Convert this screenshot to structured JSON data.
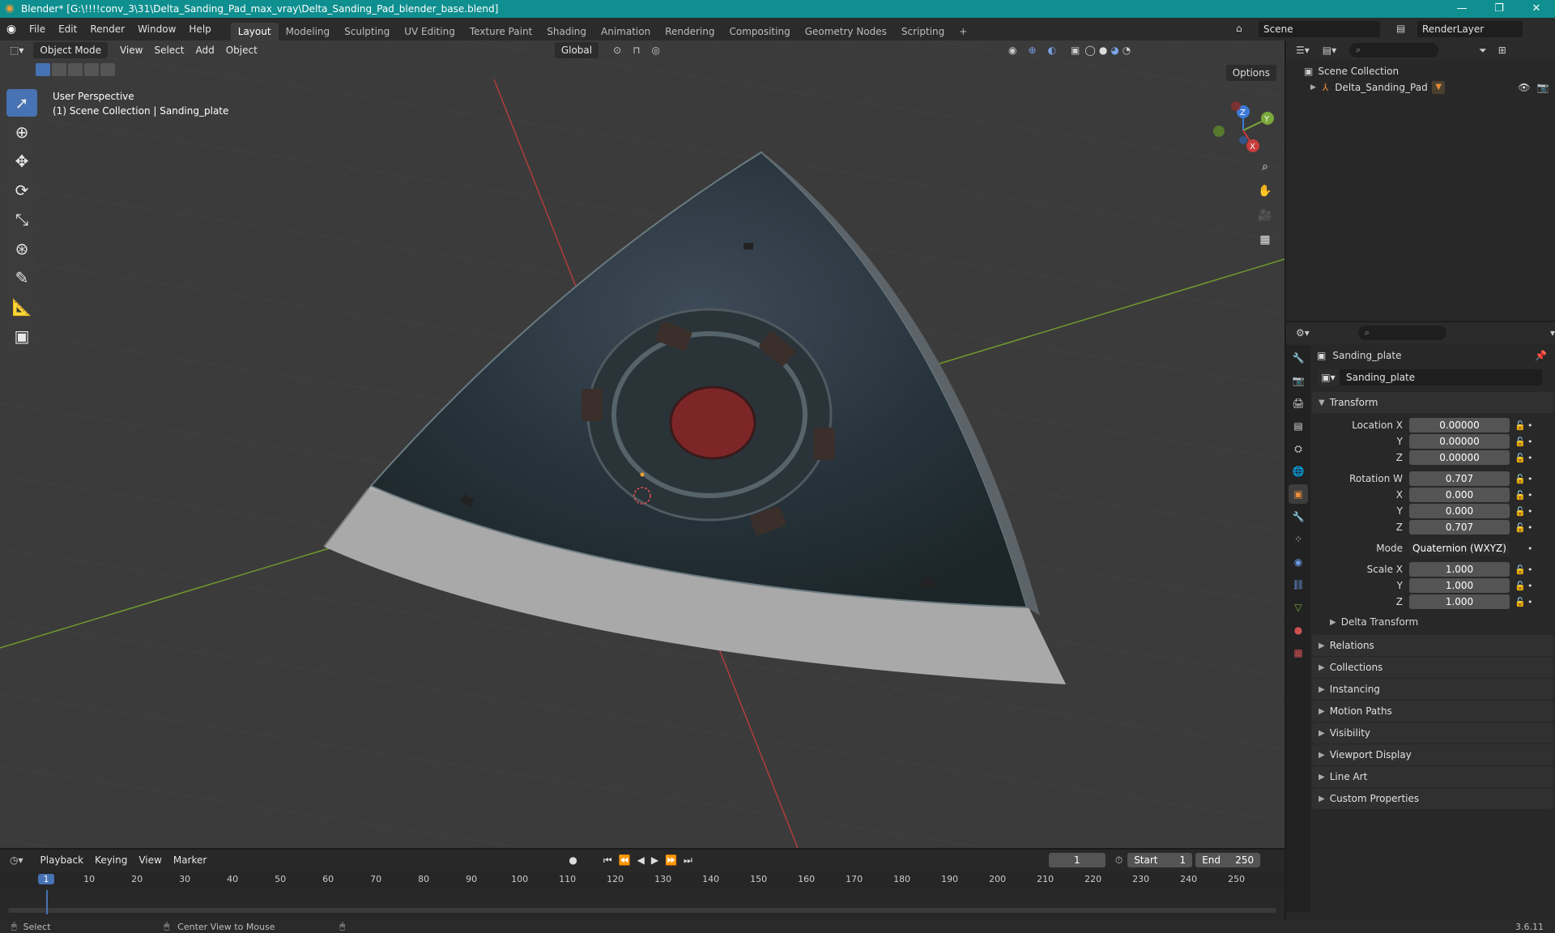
{
  "window": {
    "title": "Blender* [G:\\!!!!conv_3\\31\\Delta_Sanding_Pad_max_vray\\Delta_Sanding_Pad_blender_base.blend]",
    "controls": [
      "—",
      "❐",
      "✕"
    ]
  },
  "menu": [
    "File",
    "Edit",
    "Render",
    "Window",
    "Help"
  ],
  "workspaces": [
    "Layout",
    "Modeling",
    "Sculpting",
    "UV Editing",
    "Texture Paint",
    "Shading",
    "Animation",
    "Rendering",
    "Compositing",
    "Geometry Nodes",
    "Scripting",
    "+"
  ],
  "scene": {
    "name": "Scene",
    "render_layer": "RenderLayer"
  },
  "viewport": {
    "mode": "Object Mode",
    "menus": [
      "View",
      "Select",
      "Add",
      "Object"
    ],
    "transform_orientation": "Global",
    "options_label": "Options",
    "info_line1": "User Perspective",
    "info_line2": "(1) Scene Collection | Sanding_plate",
    "gizmo_labels": {
      "x": "X",
      "y": "Y",
      "z": "Z"
    }
  },
  "outliner": {
    "root": "Scene Collection",
    "items": [
      {
        "name": "Delta_Sanding_Pad"
      }
    ]
  },
  "properties": {
    "object_name": "Sanding_plate",
    "data_name": "Sanding_plate",
    "transform_header": "Transform",
    "location": {
      "label": "Location X",
      "x": "0.00000",
      "y": "0.00000",
      "z": "0.00000"
    },
    "rotation": {
      "label": "Rotation W",
      "w": "0.707",
      "x": "0.000",
      "y": "0.000",
      "z": "0.707"
    },
    "mode_label": "Mode",
    "mode_value": "Quaternion (WXYZ)",
    "scale": {
      "label": "Scale X",
      "x": "1.000",
      "y": "1.000",
      "z": "1.000"
    },
    "axis_labels": {
      "y": "Y",
      "z": "Z",
      "x": "X"
    },
    "delta_transform": "Delta Transform",
    "panels": [
      "Relations",
      "Collections",
      "Instancing",
      "Motion Paths",
      "Visibility",
      "Viewport Display",
      "Line Art",
      "Custom Properties"
    ]
  },
  "timeline": {
    "menus": [
      "Playback",
      "Keying",
      "View",
      "Marker"
    ],
    "current_frame": "1",
    "start_label": "Start",
    "start_value": "1",
    "end_label": "End",
    "end_value": "250",
    "ticks": [
      "1",
      "10",
      "20",
      "30",
      "40",
      "50",
      "60",
      "70",
      "80",
      "90",
      "100",
      "110",
      "120",
      "130",
      "140",
      "150",
      "160",
      "170",
      "180",
      "190",
      "200",
      "210",
      "220",
      "230",
      "240",
      "250"
    ]
  },
  "statusbar": {
    "select": "Select",
    "center_view": "Center View to Mouse",
    "version": "3.6.11"
  },
  "colors": {
    "accent": "#4772b3",
    "titlebar": "#0f8f8f",
    "axis_x": "#c83c3c",
    "axis_y": "#7aa83a",
    "axis_z": "#3d7ad8"
  }
}
